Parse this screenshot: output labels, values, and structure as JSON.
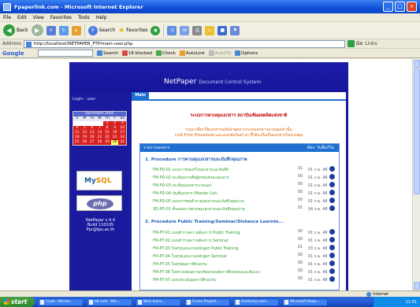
{
  "window": {
    "title": "Fpaperlink.com - Microsoft Internet Explorer"
  },
  "menu": [
    "File",
    "Edit",
    "View",
    "Favorites",
    "Tools",
    "Help"
  ],
  "toolbar": {
    "back": "Back",
    "search": "Search",
    "favorites": "Favorites"
  },
  "address": {
    "label": "Address",
    "url": "http://localhost/NETPAPER_FTP/main-user.php",
    "go": "Go",
    "links": "Links"
  },
  "googlebar": {
    "logo": "Google",
    "search": "Search",
    "blocked": "18 blocked",
    "check": "Check",
    "autolink": "AutoLink",
    "autofill": "AutoFill",
    "options": "Options"
  },
  "page": {
    "brand": "NetPaper",
    "brand_sub": "Document Control System",
    "login": "Login : user",
    "calendar": {
      "month": "December 2005",
      "dow": [
        "S",
        "M",
        "Tu",
        "W",
        "Th",
        "F",
        "Sa"
      ],
      "days": [
        "",
        "",
        "",
        "",
        "1",
        "2",
        "3",
        "4",
        "5",
        "6",
        "7",
        "8",
        "9",
        "10",
        "11",
        "12",
        "13",
        "14",
        "15",
        "16",
        "17",
        "18",
        "19",
        "20",
        "21",
        "22",
        "23",
        "24",
        "25",
        "26",
        "27",
        "28",
        "29",
        "30",
        "31"
      ],
      "today": "30"
    },
    "logo_mysql": "MySQL",
    "logo_php": "php",
    "version": [
      "NetPaper v 4.4",
      "Build 110105",
      "Ppr@tpu.ac.th"
    ],
    "tab": "Main",
    "heading": "ระบบการควบคุมเอกสาร สถาบันเพิ่มผลผลิตแห่งชาติ",
    "notice1": "กรุณาเลือกใช้เอกสารฉบับล่าสุดจากระบบเอกสารควบคุมเท่านั้น",
    "notice2": "กรณี Print Procedure และแบบฟอร์มต่างๆ ที่ได้จะถือเป็นเอกสารไม่ควบคุม",
    "list_header": {
      "name": "รายการเอกสาร",
      "rev": "Rev",
      "date": "วันที่แก้ไข"
    },
    "categories": [
      {
        "title": "1. Procedure การควบคุมเอกสารและบันทึกคุณภาพ",
        "rows": [
          {
            "code": "FM-PD-01 แบบการขอแก้ไขเอกสารและบันทึก",
            "rev": "01",
            "date": "01 ก.พ. 48"
          },
          {
            "code": "FM-PD-02 ทะเบียนรายชื่อผู้ครอบครองเอกสาร",
            "rev": "00",
            "date": "01 ก.พ. 48"
          },
          {
            "code": "FM-PD-03 ทะเบียนเอกสารภายนอก",
            "rev": "00",
            "date": "01 ก.พ. 48"
          },
          {
            "code": "FM-PD-04 บัญชีเอกสาร (Master List)",
            "rev": "00",
            "date": "01 ก.พ. 48"
          },
          {
            "code": "FM-PD-05 แบบการขอทำลายเอกสารและบันทึกคุณภาพ",
            "rev": "00",
            "date": "01 ก.พ. 48"
          },
          {
            "code": "SD-PD-01 ขั้นตอนการควบคุมเอกสารและบันทึกคุณภาพ",
            "rev": "01",
            "date": "04 ก.พ. 48"
          }
        ]
      },
      {
        "title": "2. Procedure Public Training/Seminar/Distance Learnin...",
        "rows": [
          {
            "code": "FM-PT-01 แบบสำรวจความต้องการ Public Training",
            "rev": "00",
            "date": "01 ก.พ. 48"
          },
          {
            "code": "FM-PT-02 แบบสำรวจความต้องการ Seminar",
            "rev": "00",
            "date": "01 ก.พ. 48"
          },
          {
            "code": "FM-PT-03 ใบสรุปแผนงานหลักสูตร Public Training",
            "rev": "01",
            "date": "03 ก.พ. 48"
          },
          {
            "code": "FM-PT-04 ใบสรุปแผนงานหลักสูตร Seminar",
            "rev": "00",
            "date": "01 ก.พ. 48"
          },
          {
            "code": "FM-PT-05 ใบสรุปผลการฝึกอบรม",
            "rev": "00",
            "date": "01 ก.พ. 48"
          },
          {
            "code": "FM-PT-06 ใบตรวจสอบความพร้อมก่อนจัดการฝึกอบรมและสัมมนา",
            "rev": "00",
            "date": "01 ก.พ. 48"
          },
          {
            "code": "FM-PT-07 แบบประเมินผลการฝึกอบรม",
            "rev": "00",
            "date": "01 ก.พ. 48"
          }
        ]
      }
    ]
  },
  "status": {
    "zone": "Internet"
  },
  "taskbar": {
    "start": "start",
    "tasks": [
      "Cuda - Micros...",
      "all.com - Mic...",
      "Wire Icons...",
      "Crane Project...",
      "Gnetcorp.com...",
      "Microsoft Powe..."
    ],
    "clock": "11:51"
  }
}
